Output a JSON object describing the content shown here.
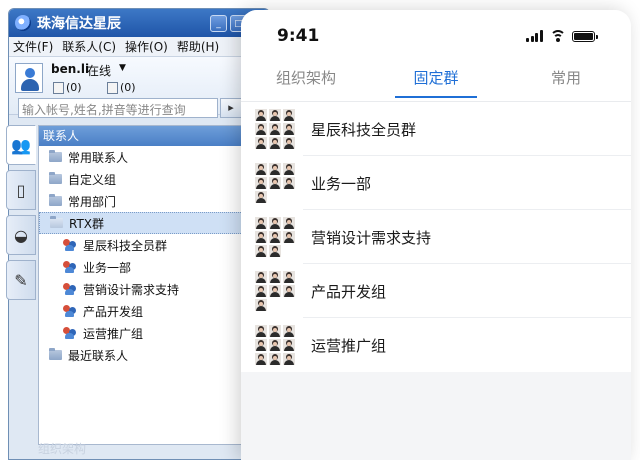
{
  "rtx": {
    "title": "珠海信达星辰",
    "menu": [
      "文件(F)",
      "联系人(C)",
      "操作(O)",
      "帮助(H)"
    ],
    "user": {
      "name": "ben.li",
      "status": "在线",
      "mail_count": "(0)",
      "sms_count": "(0)"
    },
    "search": {
      "placeholder": "输入帐号,姓名,拼音等进行查询"
    },
    "tree_header": "联系人",
    "tree": [
      {
        "label": "常用联系人",
        "type": "folder",
        "level": 0
      },
      {
        "label": "自定义组",
        "type": "folder",
        "level": 0
      },
      {
        "label": "常用部门",
        "type": "folder",
        "level": 0
      },
      {
        "label": "RTX群",
        "type": "folder-open",
        "level": 0,
        "selected": true
      },
      {
        "label": "星辰科技全员群",
        "type": "group",
        "level": 1
      },
      {
        "label": "业务一部",
        "type": "group",
        "level": 1
      },
      {
        "label": "营销设计需求支持",
        "type": "group",
        "level": 1
      },
      {
        "label": "产品开发组",
        "type": "group",
        "level": 1
      },
      {
        "label": "运营推广组",
        "type": "group",
        "level": 1
      },
      {
        "label": "最近联系人",
        "type": "folder",
        "level": 0
      }
    ],
    "footer_tab": "组织架构"
  },
  "phone": {
    "time": "9:41",
    "tabs": [
      {
        "label": "组织架构",
        "active": false
      },
      {
        "label": "固定群",
        "active": true
      },
      {
        "label": "常用",
        "active": false
      }
    ],
    "accent": "#1f6fd6",
    "groups": [
      {
        "name": "星辰科技全员群",
        "members": 9
      },
      {
        "name": "业务一部",
        "members": 7
      },
      {
        "name": "营销设计需求支持",
        "members": 8
      },
      {
        "name": "产品开发组",
        "members": 7
      },
      {
        "name": "运营推广组",
        "members": 9
      }
    ]
  }
}
